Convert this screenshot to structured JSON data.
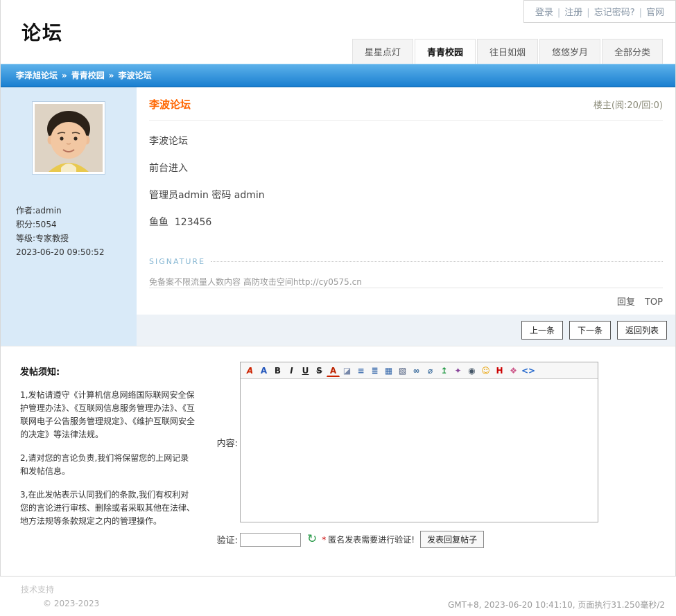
{
  "topbar": {
    "separator": "|",
    "links": [
      {
        "label": "登录"
      },
      {
        "label": "注册"
      },
      {
        "label": "忘记密码?"
      },
      {
        "label": "官网"
      }
    ]
  },
  "site": {
    "title": "论坛"
  },
  "nav": {
    "tabs": [
      {
        "label": "星星点灯",
        "active": false
      },
      {
        "label": "青青校园",
        "active": true
      },
      {
        "label": "往日如烟",
        "active": false
      },
      {
        "label": "悠悠岁月",
        "active": false
      },
      {
        "label": "全部分类",
        "active": false
      }
    ]
  },
  "breadcrumb": {
    "separator": "»",
    "parts": [
      {
        "label": "李泽旭论坛"
      },
      {
        "label": "青青校园"
      },
      {
        "label": "李波论坛"
      }
    ]
  },
  "post": {
    "title": "李波论坛",
    "meta": "楼主(阅:20/回:0)",
    "author": {
      "name": "作者:admin",
      "points": "积分:5054",
      "level": "等级:专家教授",
      "date": "2023-06-20 09:50:52"
    },
    "body": [
      "李波论坛",
      "前台进入",
      "管理员admin 密码 admin",
      "鱼鱼  123456"
    ],
    "signature_label": "SIGNATURE",
    "signature_text": "免备案不限流量人数内容 高防攻击空间http://cy0575.cn",
    "reply_link": "回复",
    "top_link": "TOP"
  },
  "pager": {
    "prev": "上一条",
    "next": "下一条",
    "back": "返回列表"
  },
  "reply_form": {
    "notice_title": "发帖须知:",
    "notice": [
      "1,发帖请遵守《计算机信息网络国际联网安全保护管理办法》、《互联网信息服务管理办法》、《互联网电子公告服务管理规定》、《维护互联网安全的决定》等法律法规。",
      "2,请对您的言论负责,我们将保留您的上网记录和发帖信息。",
      "3,在此发帖表示认同我们的条款,我们有权利对您的言论进行审核、删除或者采取其他在法律、地方法规等条款规定之内的管理操作。"
    ],
    "content_label": "内容:",
    "captcha_label": "验证:",
    "captcha_star": "*",
    "captcha_hint": "匿名发表需要进行验证!",
    "submit_label": "发表回复帖子"
  },
  "editor": {
    "toolbar": [
      {
        "name": "spellcheck-icon",
        "glyph": "A",
        "color": "#cc2200"
      },
      {
        "name": "font-icon",
        "glyph": "A",
        "color": "#2255bb"
      },
      {
        "name": "bold-icon",
        "glyph": "B",
        "color": "#222222"
      },
      {
        "name": "italic-icon",
        "glyph": "I",
        "color": "#222222"
      },
      {
        "name": "underline-icon",
        "glyph": "U",
        "color": "#222222"
      },
      {
        "name": "strikethrough-icon",
        "glyph": "S",
        "color": "#222222"
      },
      {
        "name": "font-color-icon",
        "glyph": "A",
        "color": "#bb2200"
      },
      {
        "name": "eraser-icon",
        "glyph": "◪",
        "color": "#7788aa"
      },
      {
        "name": "align-icon",
        "glyph": "≡",
        "color": "#3366aa"
      },
      {
        "name": "list-icon",
        "glyph": "≣",
        "color": "#3366aa"
      },
      {
        "name": "table-icon",
        "glyph": "▦",
        "color": "#3366aa"
      },
      {
        "name": "image-icon",
        "glyph": "▧",
        "color": "#445577"
      },
      {
        "name": "link-icon",
        "glyph": "∞",
        "color": "#336699"
      },
      {
        "name": "unlink-icon",
        "glyph": "⌀",
        "color": "#336699"
      },
      {
        "name": "upload-icon",
        "glyph": "↥",
        "color": "#229944"
      },
      {
        "name": "flash-icon",
        "glyph": "✦",
        "color": "#884499"
      },
      {
        "name": "media-icon",
        "glyph": "◉",
        "color": "#445566"
      },
      {
        "name": "smiley-icon",
        "glyph": "☺",
        "color": "#e8a000"
      },
      {
        "name": "html-icon",
        "glyph": "H",
        "color": "#cc0000"
      },
      {
        "name": "palette-icon",
        "glyph": "❖",
        "color": "#cc5588"
      },
      {
        "name": "code-icon",
        "glyph": "<>",
        "color": "#2266cc"
      }
    ],
    "refresh_glyph": "↻"
  },
  "footer": {
    "support": "技术支持",
    "copyright": "© 2023-2023",
    "info": "GMT+8, 2023-06-20 10:41:10, 页面执行31.250毫秒/2"
  },
  "colors": {
    "accent_blue": "#1a7fd0",
    "title_orange": "#ff6600",
    "sidebar_blue": "#d9eaf8"
  }
}
